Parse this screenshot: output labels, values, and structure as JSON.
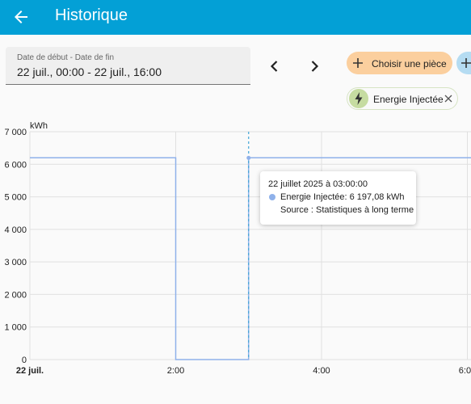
{
  "header": {
    "title": "Historique",
    "back_icon": "arrow-left-icon"
  },
  "date_range": {
    "label": "Date de début - Date de fin",
    "value": "22 juil., 00:00 - 22 juil., 16:00"
  },
  "nav": {
    "prev_icon": "chevron-left-icon",
    "next_icon": "chevron-right-icon"
  },
  "room_button": {
    "label": "Choisir une pièce",
    "color": "#fbcf9e"
  },
  "chip": {
    "label": "Energie Injectée",
    "icon": "lightning-icon",
    "color": "#c6dca1"
  },
  "tooltip": {
    "title": "22 juillet 2025 à 03:00:00",
    "series_text": "Energie Injectée: 6 197,08 kWh",
    "source_text": "Source : Statistiques à long terme"
  },
  "chart_data": {
    "type": "line",
    "unit": "kWh",
    "ylim": [
      0,
      7000
    ],
    "y_ticks": [
      "0",
      "1 000",
      "2 000",
      "3 000",
      "4 000",
      "5 000",
      "6 000",
      "7 000"
    ],
    "x_ticks": [
      {
        "label": "22 juil.",
        "t": 0,
        "bold": true
      },
      {
        "label": "2:00",
        "t": 2,
        "bold": false
      },
      {
        "label": "4:00",
        "t": 4,
        "bold": false
      },
      {
        "label": "6:00",
        "t": 6,
        "bold": false
      }
    ],
    "x_range_hours": [
      0,
      6.05
    ],
    "series": [
      {
        "name": "Energie Injectée",
        "color": "#8fb1ea",
        "points": [
          [
            0,
            6197.08
          ],
          [
            2,
            6197.08
          ],
          [
            2,
            0
          ],
          [
            3,
            0
          ],
          [
            3,
            6197.08
          ],
          [
            6.05,
            6197.08
          ]
        ]
      }
    ],
    "hover_x": 3,
    "grid": true
  }
}
